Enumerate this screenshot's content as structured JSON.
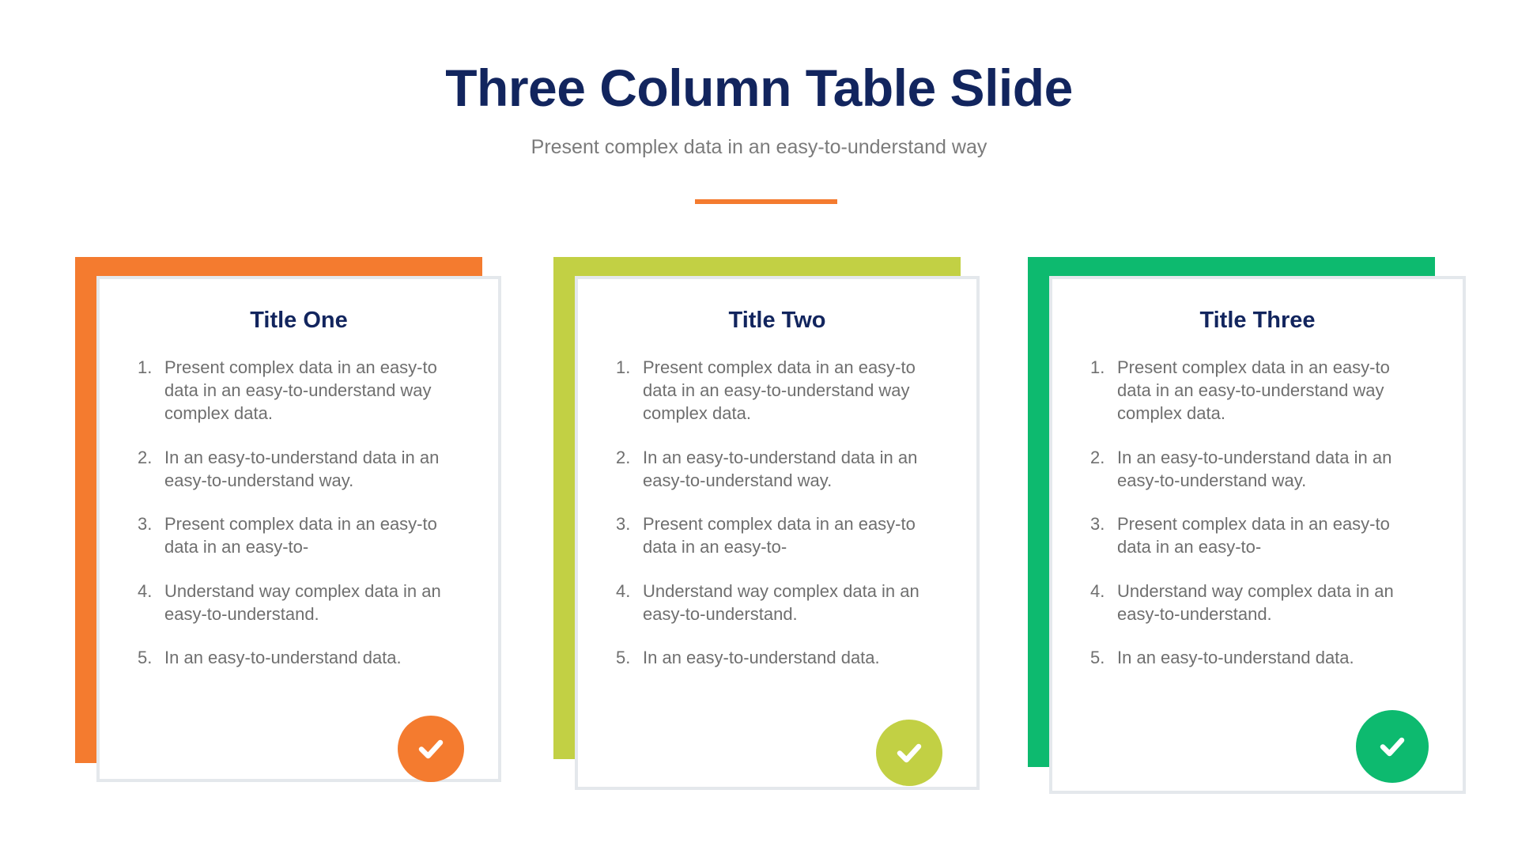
{
  "header": {
    "title": "Three Column Table Slide",
    "subtitle": "Present complex data in an easy-to-understand way",
    "title_color": "#12255e",
    "subtitle_color": "#7b7b7b",
    "divider_color": "#f47b2f"
  },
  "columns": [
    {
      "title": "Title One",
      "accent_color": "#f47b2f",
      "badge_icon": "check-icon",
      "items": [
        {
          "number": "1.",
          "text": "Present complex data in an easy-to data in an easy-to-understand way complex data."
        },
        {
          "number": "2.",
          "text": "In an easy-to-understand data in an easy-to-understand way."
        },
        {
          "number": "3.",
          "text": "Present complex data in an easy-to data in an easy-to-"
        },
        {
          "number": "4.",
          "text": "Understand way complex data in an easy-to-understand."
        },
        {
          "number": "5.",
          "text": "In an easy-to-understand data."
        }
      ]
    },
    {
      "title": "Title Two",
      "accent_color": "#c2d044",
      "badge_icon": "check-icon",
      "items": [
        {
          "number": "1.",
          "text": "Present complex data in an easy-to data in an easy-to-understand way complex data."
        },
        {
          "number": "2.",
          "text": "In an easy-to-understand data in an easy-to-understand way."
        },
        {
          "number": "3.",
          "text": "Present complex data in an easy-to data in an easy-to-"
        },
        {
          "number": "4.",
          "text": "Understand way complex data in an easy-to-understand."
        },
        {
          "number": "5.",
          "text": "In an easy-to-understand data."
        }
      ]
    },
    {
      "title": "Title Three",
      "accent_color": "#0dba6f",
      "badge_icon": "check-icon",
      "items": [
        {
          "number": "1.",
          "text": "Present complex data in an easy-to data in an easy-to-understand way complex data."
        },
        {
          "number": "2.",
          "text": "In an easy-to-understand data in an easy-to-understand way."
        },
        {
          "number": "3.",
          "text": "Present complex data in an easy-to data in an easy-to-"
        },
        {
          "number": "4.",
          "text": "Understand way complex data in an easy-to-understand."
        },
        {
          "number": "5.",
          "text": "In an easy-to-understand data."
        }
      ]
    }
  ]
}
